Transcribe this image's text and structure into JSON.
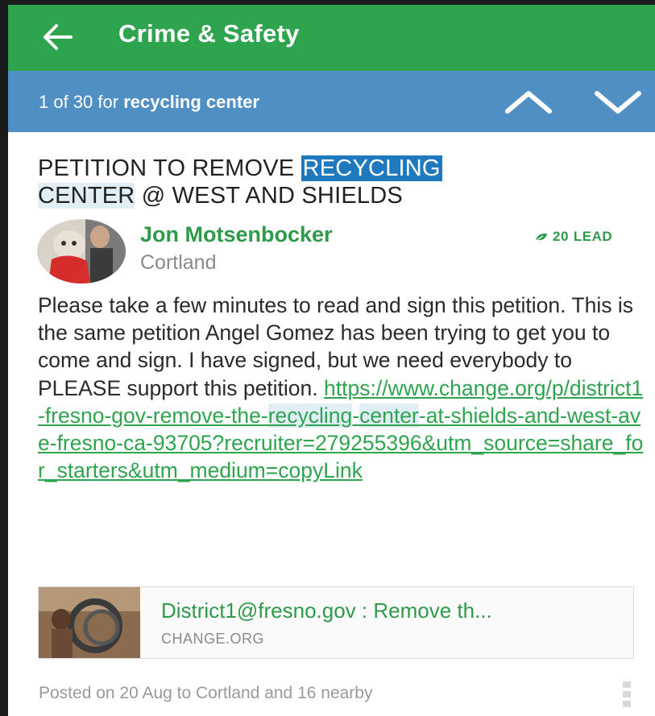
{
  "appbar": {
    "title": "Crime & Safety",
    "back_icon": "arrow-left-icon",
    "color": "#2fa44f"
  },
  "search": {
    "status_prefix": "1 of 30 for",
    "query": "recycling center",
    "up_icon": "chevron-up-icon",
    "down_icon": "chevron-down-icon",
    "color": "#4f8fc4"
  },
  "post": {
    "title_part1": "PETITION TO REMOVE ",
    "title_highlight1": "RECYCLING",
    "title_highlight2": "CENTER",
    "title_part2": " @ WEST AND SHIELDS",
    "author": "Jon Motsenbocker",
    "location": "Cortland",
    "lead_count": "20",
    "lead_label": "LEAD",
    "body": "Please take a few minutes to read and sign this petition. This is the same petition Angel Gomez has been trying to get you to come and sign. I have signed, but we need everybody to PLEASE support this petition. ",
    "link_part1": "https://www.change.org/p/district1-fresno-gov-remove-the-",
    "link_hl1": "recycling",
    "link_mid": "-",
    "link_hl2": "center",
    "link_part2": "-at-shields-and-west-ave-fresno-ca-93705?recruiter=279255396&utm_source=share_for_starters&utm_medium=copyLink",
    "link_card": {
      "title": "District1@fresno.gov : Remove th...",
      "domain": "CHANGE.ORG"
    },
    "posted": "Posted on 20 Aug to Cortland and 16 nearby"
  }
}
